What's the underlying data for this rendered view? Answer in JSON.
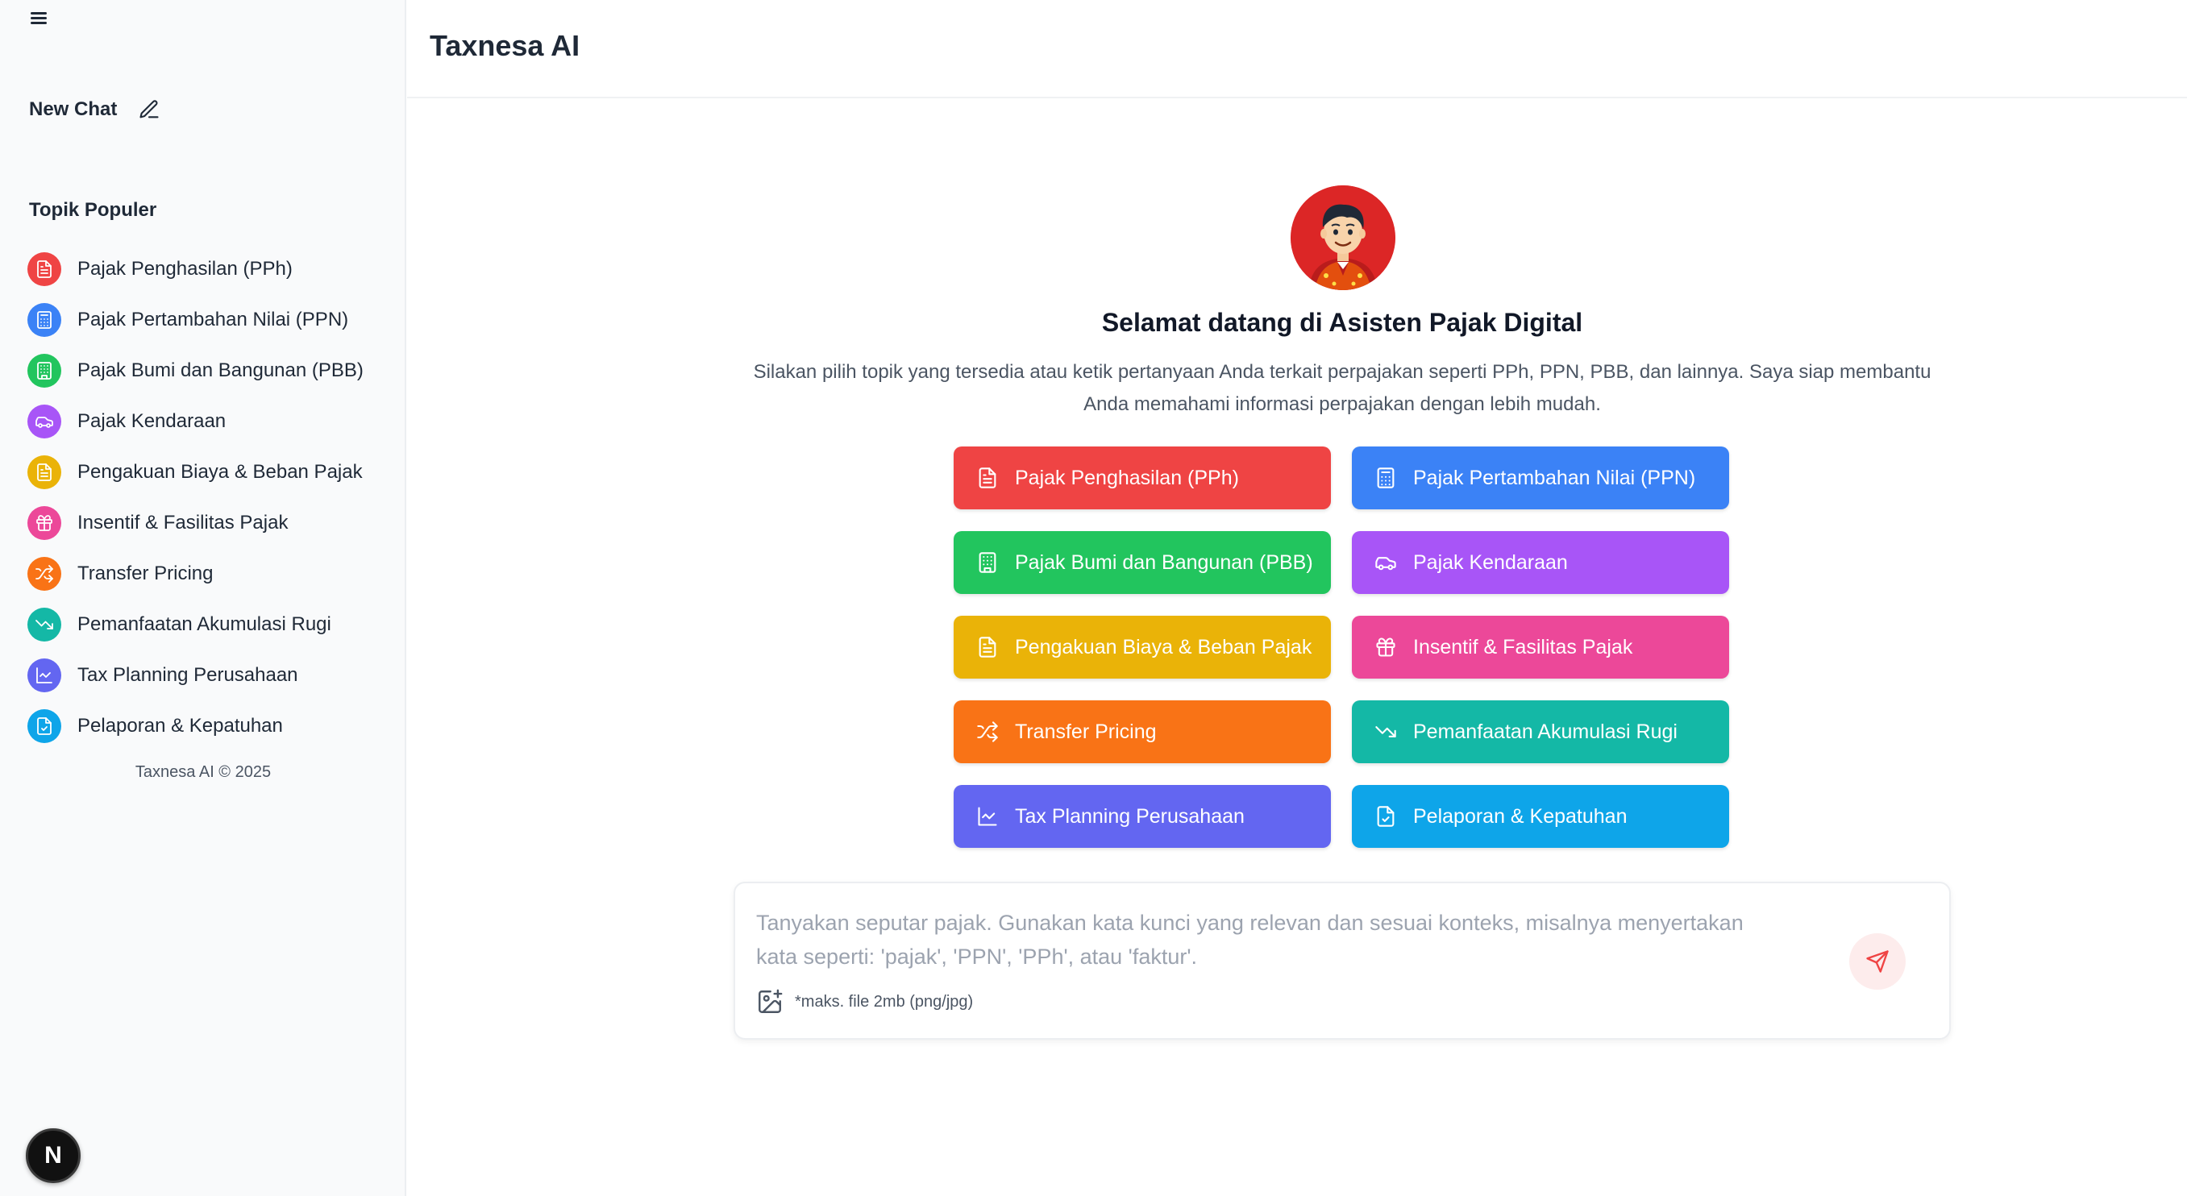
{
  "sidebar": {
    "new_chat_label": "New Chat",
    "topics_title": "Topik Populer",
    "topics": [
      {
        "label": "Pajak Penghasilan (PPh)",
        "color": "#ef4444",
        "icon": "file-text-icon"
      },
      {
        "label": "Pajak Pertambahan Nilai (PPN)",
        "color": "#3b82f6",
        "icon": "calculator-icon"
      },
      {
        "label": "Pajak Bumi dan Bangunan (PBB)",
        "color": "#22c55e",
        "icon": "building-icon"
      },
      {
        "label": "Pajak Kendaraan",
        "color": "#a855f7",
        "icon": "car-icon"
      },
      {
        "label": "Pengakuan Biaya & Beban Pajak",
        "color": "#eab308",
        "icon": "file-text-icon"
      },
      {
        "label": "Insentif & Fasilitas Pajak",
        "color": "#ec4899",
        "icon": "gift-icon"
      },
      {
        "label": "Transfer Pricing",
        "color": "#f97316",
        "icon": "shuffle-icon"
      },
      {
        "label": "Pemanfaatan Akumulasi Rugi",
        "color": "#14b8a6",
        "icon": "trending-down-icon"
      },
      {
        "label": "Tax Planning Perusahaan",
        "color": "#6366f1",
        "icon": "line-chart-icon"
      },
      {
        "label": "Pelaporan & Kepatuhan",
        "color": "#0ea5e9",
        "icon": "file-check-icon"
      }
    ],
    "copyright": "Taxnesa AI © 2025",
    "avatar_letter": "N"
  },
  "header": {
    "title": "Taxnesa AI"
  },
  "main": {
    "welcome_title": "Selamat datang di Asisten Pajak Digital",
    "welcome_text": "Silakan pilih topik yang tersedia atau ketik pertanyaan Anda terkait perpajakan seperti PPh, PPN, PBB, dan lainnya. Saya siap membantu Anda memahami informasi perpajakan dengan lebih mudah.",
    "topic_buttons": [
      {
        "label": "Pajak Penghasilan (PPh)",
        "color": "#ef4444",
        "icon": "file-text-icon"
      },
      {
        "label": "Pajak Pertambahan Nilai (PPN)",
        "color": "#3b82f6",
        "icon": "calculator-icon"
      },
      {
        "label": "Pajak Bumi dan Bangunan (PBB)",
        "color": "#22c55e",
        "icon": "building-icon"
      },
      {
        "label": "Pajak Kendaraan",
        "color": "#a855f7",
        "icon": "car-icon"
      },
      {
        "label": "Pengakuan Biaya & Beban Pajak",
        "color": "#eab308",
        "icon": "file-text-icon"
      },
      {
        "label": "Insentif & Fasilitas Pajak",
        "color": "#ec4899",
        "icon": "gift-icon"
      },
      {
        "label": "Transfer Pricing",
        "color": "#f97316",
        "icon": "shuffle-icon"
      },
      {
        "label": "Pemanfaatan Akumulasi Rugi",
        "color": "#14b8a6",
        "icon": "trending-down-icon"
      },
      {
        "label": "Tax Planning Perusahaan",
        "color": "#6366f1",
        "icon": "line-chart-icon"
      },
      {
        "label": "Pelaporan & Kepatuhan",
        "color": "#0ea5e9",
        "icon": "file-check-icon"
      }
    ],
    "input": {
      "placeholder": "Tanyakan seputar pajak. Gunakan kata kunci yang relevan dan sesuai konteks, misalnya menyertakan kata seperti: 'pajak', 'PPN', 'PPh', atau 'faktur'.",
      "attach_note": "*maks. file 2mb (png/jpg)",
      "send_color": "#ef4444"
    }
  }
}
